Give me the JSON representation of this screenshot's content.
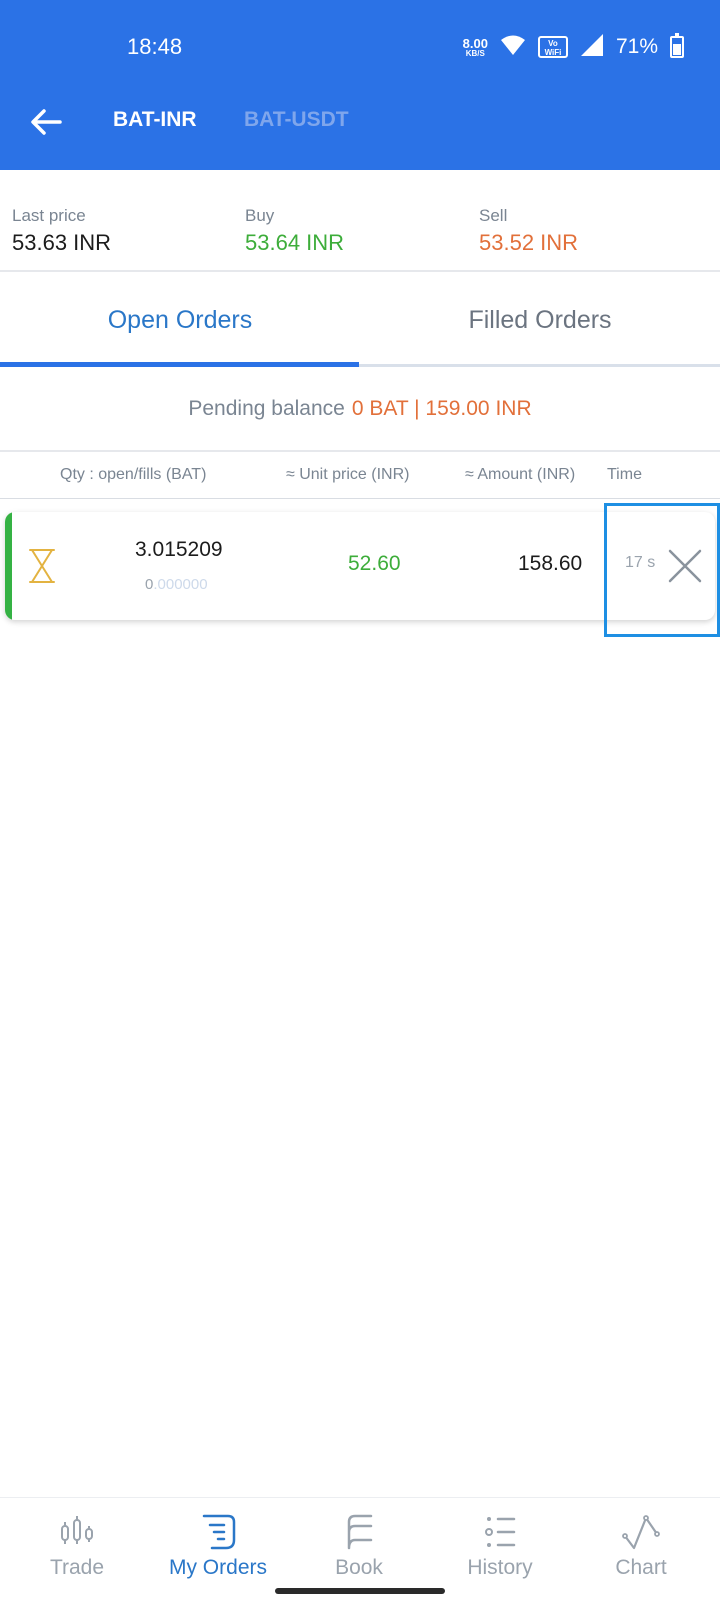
{
  "status_bar": {
    "time": "18:48",
    "net_speed_value": "8.00",
    "net_speed_unit": "KB/S",
    "vowifi_top": "Vo",
    "vowifi_bottom": "WiFi",
    "battery_percent": "71%",
    "battery_level": 0.71,
    "icons": [
      "wifi-icon",
      "signal-icon",
      "battery-icon"
    ]
  },
  "header": {
    "back_icon": "arrow-left-icon",
    "pairs": [
      {
        "label": "BAT-INR",
        "active": true
      },
      {
        "label": "BAT-USDT",
        "active": false
      }
    ]
  },
  "prices": {
    "last_label": "Last price",
    "last_value": "53.63 INR",
    "buy_label": "Buy",
    "buy_value": "53.64  INR",
    "sell_label": "Sell",
    "sell_value": "53.52  INR"
  },
  "order_tabs": {
    "open": "Open Orders",
    "filled": "Filled Orders",
    "active": "open"
  },
  "pending": {
    "label": "Pending balance",
    "amount": "0 BAT | 159.00 INR"
  },
  "columns": {
    "qty": "Qty : open/fills (BAT)",
    "unit_price": "≈ Unit price (INR)",
    "amount": "≈ Amount (INR)",
    "time": "Time"
  },
  "orders": [
    {
      "status_icon": "hourglass-icon",
      "qty_open": "3.015209",
      "qty_fill_lead": "0",
      "qty_fill_rest": ".000000",
      "unit_price": "52.60",
      "amount": "158.60",
      "time": "17 s",
      "side": "buy"
    }
  ],
  "bottom_nav": [
    {
      "label": "Trade",
      "icon": "candles-icon",
      "active": false
    },
    {
      "label": "My Orders",
      "icon": "orders-icon",
      "active": true
    },
    {
      "label": "Book",
      "icon": "book-icon",
      "active": false
    },
    {
      "label": "History",
      "icon": "history-icon",
      "active": false
    },
    {
      "label": "Chart",
      "icon": "chart-icon",
      "active": false
    }
  ],
  "colors": {
    "primary": "#2b72e6",
    "buy_green": "#3dad3a",
    "sell_orange": "#e2703a",
    "highlight": "#1e8fe3"
  }
}
